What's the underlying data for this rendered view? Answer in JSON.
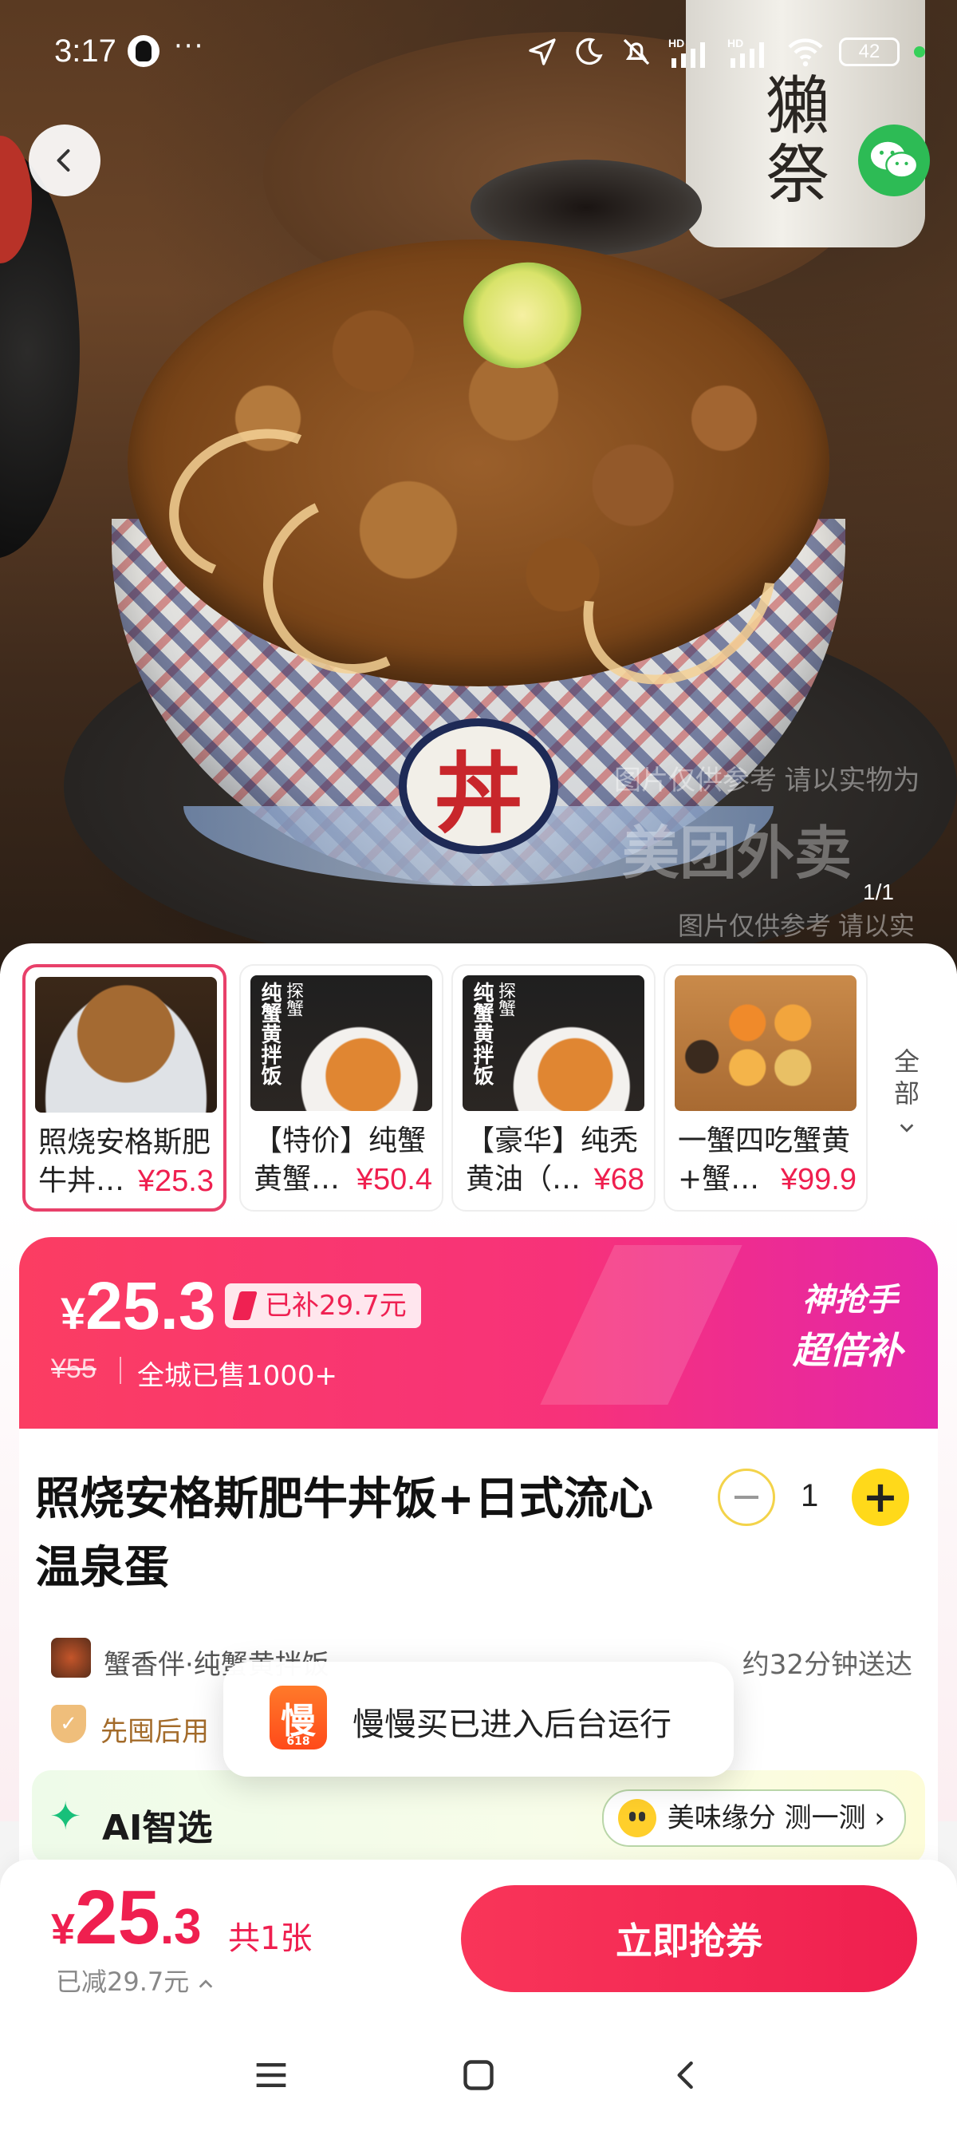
{
  "status_bar": {
    "time": "3:17",
    "more_dots": "···",
    "battery": "42"
  },
  "hero": {
    "bottle_text": "獺祭",
    "bowl_emblem": "丼",
    "watermark_1": "图片仅供参考 请以实物为",
    "watermark_2": "美团外卖",
    "watermark_3": "图片仅供参考 请以实",
    "image_counter": "1/1"
  },
  "thumbnails": [
    {
      "line1": "照烧安格斯肥",
      "line2": "牛丼…",
      "price": "¥25.3",
      "active": true
    },
    {
      "line1": "【特价】纯蟹",
      "line2": "黄蟹…",
      "price": "¥50.4",
      "image_text": "纯蟹黄拌饭",
      "image_text2": "探蟹",
      "active": false
    },
    {
      "line1": "【豪华】纯秃",
      "line2": "黄油（…",
      "price": "¥68",
      "image_text": "纯蟹黄拌饭",
      "image_text2": "探蟹",
      "active": false
    },
    {
      "line1": "一蟹四吃蟹黄",
      "line2": "+蟹…",
      "price": "¥99.9",
      "active": false
    }
  ],
  "thumb_all_label": "全部",
  "price_banner": {
    "currency": "¥",
    "price": "25.3",
    "subsidy": "已补29.7元",
    "original_price": "¥55",
    "sold": "全城已售1000+",
    "promo_line1": "神抢手",
    "promo_line2": "超倍补"
  },
  "product": {
    "title": "照烧安格斯肥牛丼饭+日式流心温泉蛋",
    "quantity": "1",
    "plus": "+",
    "store_name": "蟹香伴·纯蟹黄拌饭",
    "delivery": "约32分钟送达",
    "tag": "先囤后用"
  },
  "ai": {
    "title": "AI智选",
    "chip": "美味缘分 测一测"
  },
  "toast": {
    "icon_char": "慢",
    "icon_sub": "618",
    "text": "慢慢买已进入后台运行"
  },
  "bottom_bar": {
    "currency": "¥",
    "price_int": "25",
    "price_dec": ".3",
    "count": "共1张",
    "saved": "已减29.7元",
    "cta": "立即抢券"
  },
  "colors": {
    "accent": "#ef1f4f",
    "banner_start": "#fb3d62",
    "banner_end": "#e426a8",
    "plus_button": "#ffd91a",
    "wechat": "#2dbb55"
  }
}
